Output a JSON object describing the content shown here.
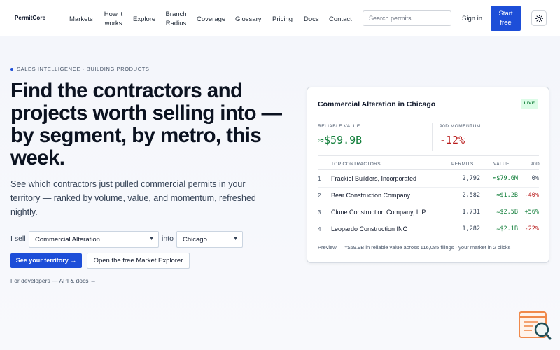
{
  "nav": {
    "logo": "PermitCore",
    "links": [
      "Markets",
      "How it works",
      "Explore",
      "Branch Radius",
      "Coverage",
      "Glossary",
      "Pricing",
      "Docs",
      "Contact"
    ],
    "search_placeholder": "Search permits...",
    "sign_in": "Sign in",
    "start_free": "Start free",
    "theme_icon": "sun-icon"
  },
  "hero": {
    "eyebrow": "SALES INTELLIGENCE · BUILDING PRODUCTS",
    "headline": "Find the contractors and projects worth selling into — by segment, by metro, this week.",
    "subtext": "See which contractors just pulled commercial permits in your territory — ranked by volume, value, and momentum, refreshed nightly.",
    "sell_label": "I sell",
    "segment_value": "Commercial Alteration",
    "into_label": "into",
    "metro_value": "Chicago",
    "cta_primary": "See your territory →",
    "cta_secondary": "Open the free Market Explorer",
    "dev_link": "For developers — API & docs →"
  },
  "card": {
    "title": "Commercial Alteration in Chicago",
    "badge": "LIVE",
    "kpis": [
      {
        "label": "RELIABLE VALUE",
        "value": "≈$59.9B",
        "color": "#15803d"
      },
      {
        "label": "90D MOMENTUM",
        "value": "-12%",
        "color": "#b91c1c"
      }
    ],
    "columns": {
      "contractors": "TOP CONTRACTORS",
      "permits": "PERMITS",
      "value": "VALUE",
      "momentum": "90D"
    },
    "rows": [
      {
        "rank": "1",
        "name": "Frackiel Builders, Incorporated",
        "permits": "2,792",
        "value": "≈$79.6M",
        "momentum": "0%",
        "momentum_color": "#334155"
      },
      {
        "rank": "2",
        "name": "Bear Construction Company",
        "permits": "2,582",
        "value": "≈$1.2B",
        "momentum": "-40%",
        "momentum_color": "#b91c1c"
      },
      {
        "rank": "3",
        "name": "Clune Construction Company, L.P.",
        "permits": "1,731",
        "value": "≈$2.5B",
        "momentum": "+56%",
        "momentum_color": "#15803d"
      },
      {
        "rank": "4",
        "name": "Leopardo Construction INC",
        "permits": "1,282",
        "value": "≈$2.1B",
        "momentum": "-22%",
        "momentum_color": "#b91c1c"
      }
    ],
    "preview": "Preview — ≈$59.9B in reliable value across 116,085 filings · your market in 2 clicks"
  },
  "colors": {
    "accent": "#1d4ed8",
    "positive": "#15803d",
    "negative": "#b91c1c"
  },
  "corner_icon": "search-document-icon"
}
